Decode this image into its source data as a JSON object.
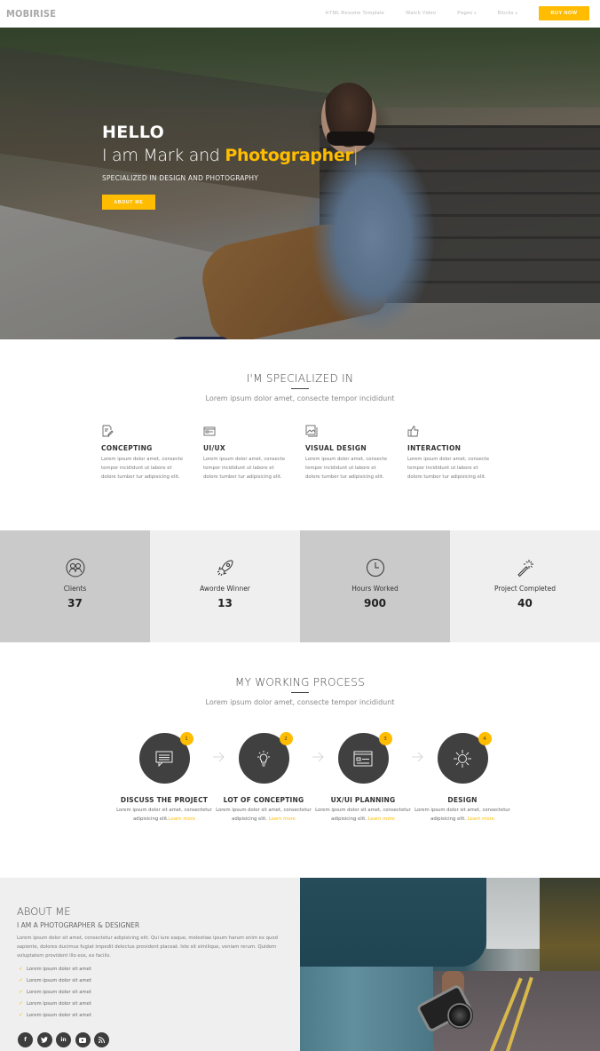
{
  "nav": {
    "brand": "MOBIRISE",
    "links": [
      {
        "label": "HTML Resume Template",
        "has_caret": false
      },
      {
        "label": "Watch Video",
        "has_caret": false
      },
      {
        "label": "Pages",
        "has_caret": true
      },
      {
        "label": "Blocks",
        "has_caret": true
      }
    ],
    "caret": "▾",
    "buy_label": "BUY NOW"
  },
  "hero": {
    "hello": "HELLO",
    "line_prefix": "I am Mark and ",
    "line_accent": "Photographer",
    "cursor": "|",
    "subtitle": "SPECIALIZED IN DESIGN AND PHOTOGRAPHY",
    "button_label": "ABOUT ME"
  },
  "specialized": {
    "title": "I'M SPECIALIZED IN",
    "subtitle": "Lorem ipsum dolor amet, consecte tempor incididunt",
    "items": [
      {
        "icon": "edit-icon",
        "name": "CONCEPTING",
        "desc": "Lorem ipsum dolor amet, consecte tempor incididunt ut labore et dolore tumber tur adipisicing elit."
      },
      {
        "icon": "browser-window-icon",
        "name": "UI/UX",
        "desc": "Lorem ipsum dolor amet, consecte tempor incididunt ut labore et dolore tumber tur adipisicing elit."
      },
      {
        "icon": "image-icon",
        "name": "VISUAL DESIGN",
        "desc": "Lorem ipsum dolor amet, consecte tempor incididunt ut labore et dolore tumber tur adipisicing elit."
      },
      {
        "icon": "thumbs-up-icon",
        "name": "INTERACTION",
        "desc": "Lorem ipsum dolor amet, consecte tempor incididunt ut labore et dolore tumber tur adipisicing elit."
      }
    ]
  },
  "stats": [
    {
      "icon": "users-icon",
      "label": "Clients",
      "value": "37"
    },
    {
      "icon": "rocket-icon",
      "label": "Aworde Winner",
      "value": "13"
    },
    {
      "icon": "clock-icon",
      "label": "Hours Worked",
      "value": "900"
    },
    {
      "icon": "magic-wand-icon",
      "label": "Project Completed",
      "value": "40"
    }
  ],
  "process": {
    "title": "MY WORKING PROCESS",
    "subtitle": "Lorem ipsum dolor amet, consecte tempor incididunt",
    "learn_more": "Learn more",
    "steps": [
      {
        "num": "1",
        "icon": "chat-icon",
        "name": "DISCUSS THE PROJECT",
        "desc": "Lorem ipsum dolor sit amet, consectetur adipisicing elit."
      },
      {
        "num": "2",
        "icon": "lightbulb-icon",
        "name": "LOT OF CONCEPTING",
        "desc": "Lorem ipsum dolor sit amet, consectetur adipisicing elit. "
      },
      {
        "num": "3",
        "icon": "browser-window-icon",
        "name": "UX/UI PLANNING",
        "desc": "Lorem ipsum dolor sit amet, consectetur adipisicing elit. "
      },
      {
        "num": "4",
        "icon": "sun-icon",
        "name": "DESIGN",
        "desc": "Lorem ipsum dolor sit amet, consectetur adipisicing elit. "
      }
    ]
  },
  "about": {
    "title": "ABOUT ME",
    "subtitle": "I AM A PHOTOGRAPHER & DESIGNER",
    "text": "Lorem ipsum dolor sit amet, consectetur adipisicing elit. Qui iure eaque, molestiae ipsum harum enim ex quod sapiente, dolores ducimus fugiat impedit delectus provident placeat. Iste sit similique, veniam rerum. Quidem voluptatem provident illo eos, ex facilis.",
    "list": [
      "Lorem ipsum dolor sit amet",
      "Lorem ipsum dolor sit amet",
      "Lorem ipsum dolor sit amet",
      "Lorem ipsum dolor sit amet",
      "Lorem ipsum dolor sit amet"
    ],
    "check": "✓",
    "socials": [
      {
        "name": "facebook-icon",
        "glyph": "f"
      },
      {
        "name": "twitter-icon",
        "glyph": "t"
      },
      {
        "name": "linkedin-icon",
        "glyph": "in"
      },
      {
        "name": "youtube-icon",
        "glyph": "▶"
      },
      {
        "name": "rss-icon",
        "glyph": ")"
      }
    ]
  },
  "colors": {
    "accent": "#ffbc00",
    "dark_circle": "#404040",
    "stat_dark": "#cacaca",
    "stat_light": "#efefef"
  }
}
